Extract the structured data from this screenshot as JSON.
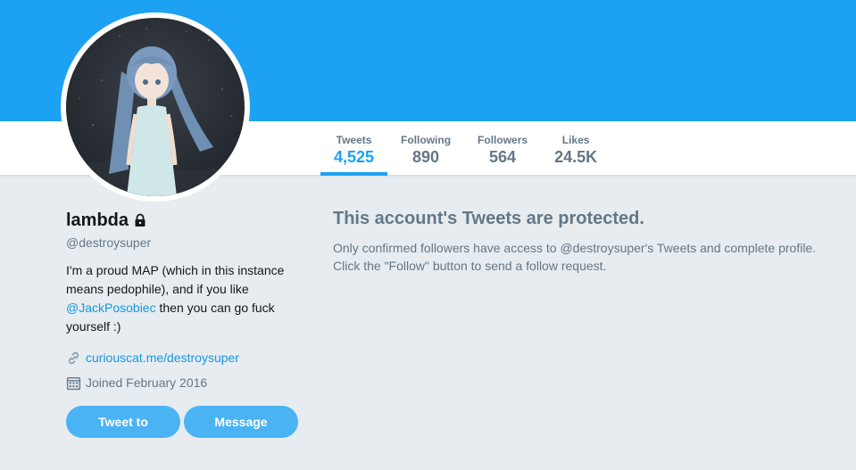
{
  "colors": {
    "banner": "#1da1f2",
    "accent": "#1da1f2",
    "button": "#4ab3f4",
    "muted": "#657786",
    "link": "#1b95e0",
    "page_bg": "#e6ecf0"
  },
  "stats": [
    {
      "label": "Tweets",
      "value": "4,525",
      "active": true
    },
    {
      "label": "Following",
      "value": "890",
      "active": false
    },
    {
      "label": "Followers",
      "value": "564",
      "active": false
    },
    {
      "label": "Likes",
      "value": "24.5K",
      "active": false
    }
  ],
  "profile": {
    "name": "lambda",
    "name_icon": "lock-icon",
    "handle": "@destroysuper",
    "bio_before": "I'm a proud MAP (which in this instance means pedophile), and if you like ",
    "bio_mention": "@JackPosobiec",
    "bio_after": " then you can go fuck yourself :)",
    "website": "curiouscat.me/destroysuper",
    "website_icon": "link-icon",
    "joined": "Joined February 2016",
    "joined_icon": "calendar-icon"
  },
  "buttons": {
    "tweet_to": "Tweet to",
    "message": "Message"
  },
  "protected": {
    "title": "This account's Tweets are protected.",
    "message": "Only confirmed followers have access to @destroysuper's Tweets and complete profile. Click the \"Follow\" button to send a follow request."
  }
}
